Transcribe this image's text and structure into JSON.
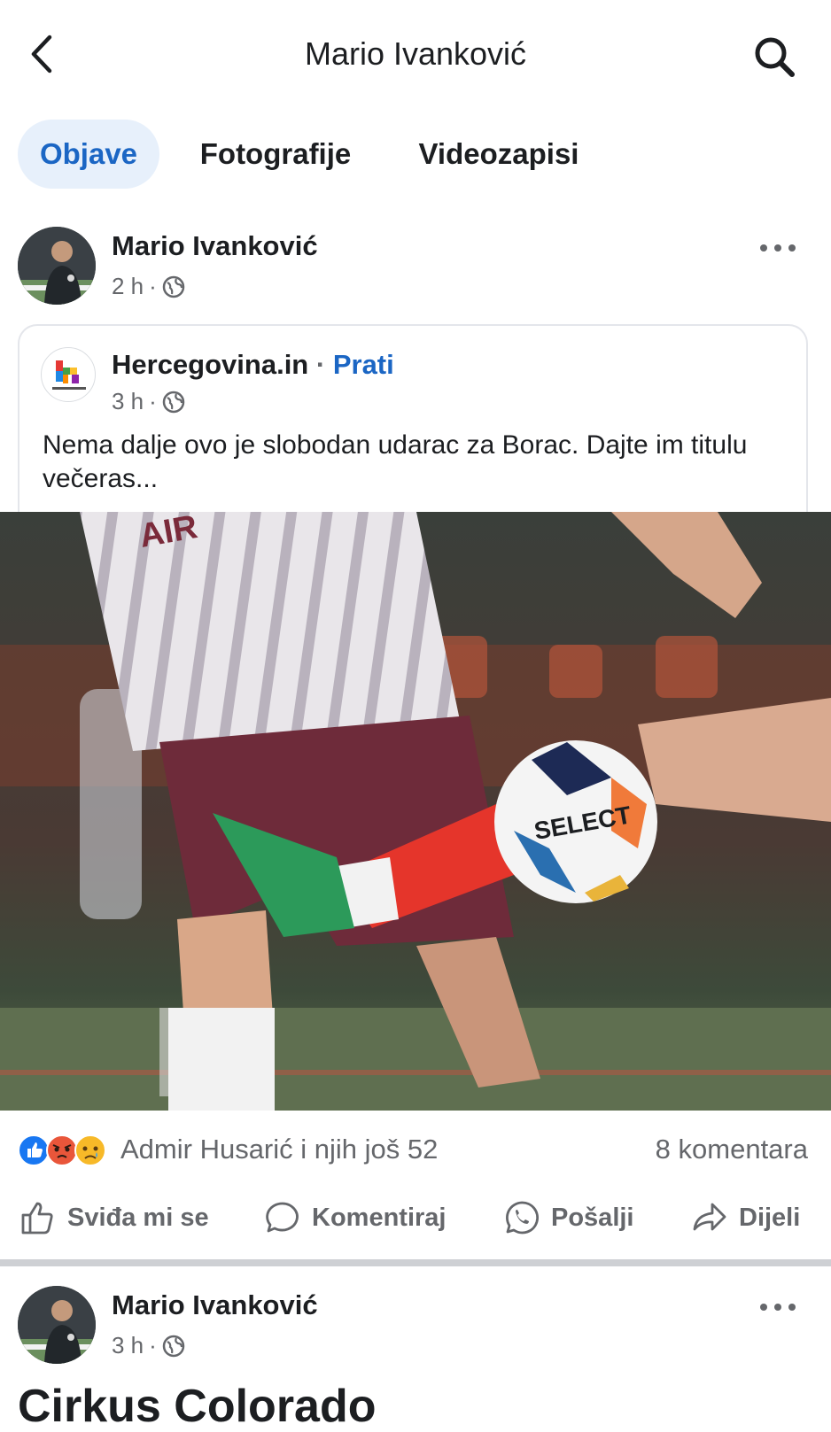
{
  "header": {
    "title": "Mario Ivanković",
    "back_icon": "chevron-left-icon",
    "search_icon": "search-icon"
  },
  "tabs": [
    {
      "label": "Objave",
      "active": true
    },
    {
      "label": "Fotografije",
      "active": false
    },
    {
      "label": "Videozapisi",
      "active": false
    }
  ],
  "post": {
    "author": "Mario Ivanković",
    "time": "2 h",
    "dot": "·",
    "privacy_icon": "globe-icon",
    "more_icon": "more-horizontal-icon",
    "shared": {
      "page_name": "Hercegovina.in",
      "separator": "·",
      "follow_label": "Prati",
      "time": "3 h",
      "dot": "·",
      "logo_caption": "hercegovina.in",
      "text": "Nema dalje ovo je slobodan udarac za Borac. Dajte im titulu večeras..."
    },
    "photo": {
      "ball_text": "SELECT",
      "jersey_text": "AIR"
    },
    "reactions": {
      "icons": [
        "like-icon",
        "angry-icon",
        "sad-icon"
      ],
      "summary": "Admir Husarić i njih još 52",
      "comments": "8 komentara"
    },
    "actions": [
      {
        "label": "Sviđa mi se",
        "icon": "thumbs-up-icon"
      },
      {
        "label": "Komentiraj",
        "icon": "comment-icon"
      },
      {
        "label": "Pošalji",
        "icon": "whatsapp-icon"
      },
      {
        "label": "Dijeli",
        "icon": "share-icon"
      }
    ]
  },
  "next_post": {
    "author": "Mario Ivanković",
    "time": "3 h",
    "dot": "·",
    "title_partial": "Cirkus Colorado"
  },
  "colors": {
    "accent": "#1b66c4",
    "tab_active_bg": "#e7f0fb",
    "secondary_text": "#65676b",
    "divider": "#ced0d4"
  }
}
